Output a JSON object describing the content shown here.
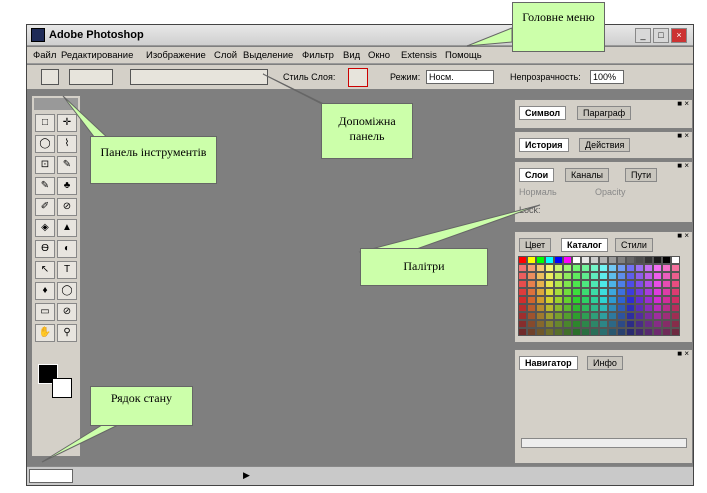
{
  "window": {
    "title": "Adobe Photoshop"
  },
  "menu": [
    "Файл",
    "Редактирование",
    "Изображение",
    "Слой",
    "Выделение",
    "Фильтр",
    "Вид",
    "Окно",
    "Extensis",
    "Помощь"
  ],
  "options": {
    "style_label": "Стиль Слоя:",
    "mode_label": "Режим:",
    "mode_value": "Носм.",
    "opacity_label": "Непрозрачность:",
    "opacity_value": "100%"
  },
  "tools": [
    "□",
    "✛",
    "◯",
    "⌇",
    "⊡",
    "✎",
    "✎",
    "♣",
    "✐",
    "⊘",
    "◈",
    "▲",
    "Ѳ",
    "◐",
    "↖",
    "T",
    "♦",
    "◯",
    "▭",
    "⊘",
    "✋",
    "⚲"
  ],
  "palettes": {
    "char": [
      "Символ",
      "Параграф"
    ],
    "history": [
      "История",
      "Действия"
    ],
    "layers": [
      "Слои",
      "Каналы",
      "Пути"
    ],
    "layers_mode": "Нормаль",
    "layers_opacity": "Opacity",
    "layers_lock": "Lock:",
    "color": [
      "Цвет",
      "Каталог",
      "Стили"
    ],
    "navigator": [
      "Навигатор",
      "Инфо"
    ]
  },
  "callouts": {
    "main_menu": "Головне меню",
    "aux_panel": "Допоміжна панель",
    "tools_panel": "Панель інструментів",
    "palettes": "Палітри",
    "status_bar": "Рядок стану"
  },
  "swatch_colors": [
    "#ff0000",
    "#ffff00",
    "#00ff00",
    "#00ffff",
    "#0000ff",
    "#ff00ff",
    "#ffffff",
    "#e6e6e6",
    "#cccccc",
    "#b3b3b3",
    "#999999",
    "#808080",
    "#666666",
    "#4d4d4d",
    "#333333",
    "#1a1a1a",
    "#000000",
    "#ffffff"
  ]
}
